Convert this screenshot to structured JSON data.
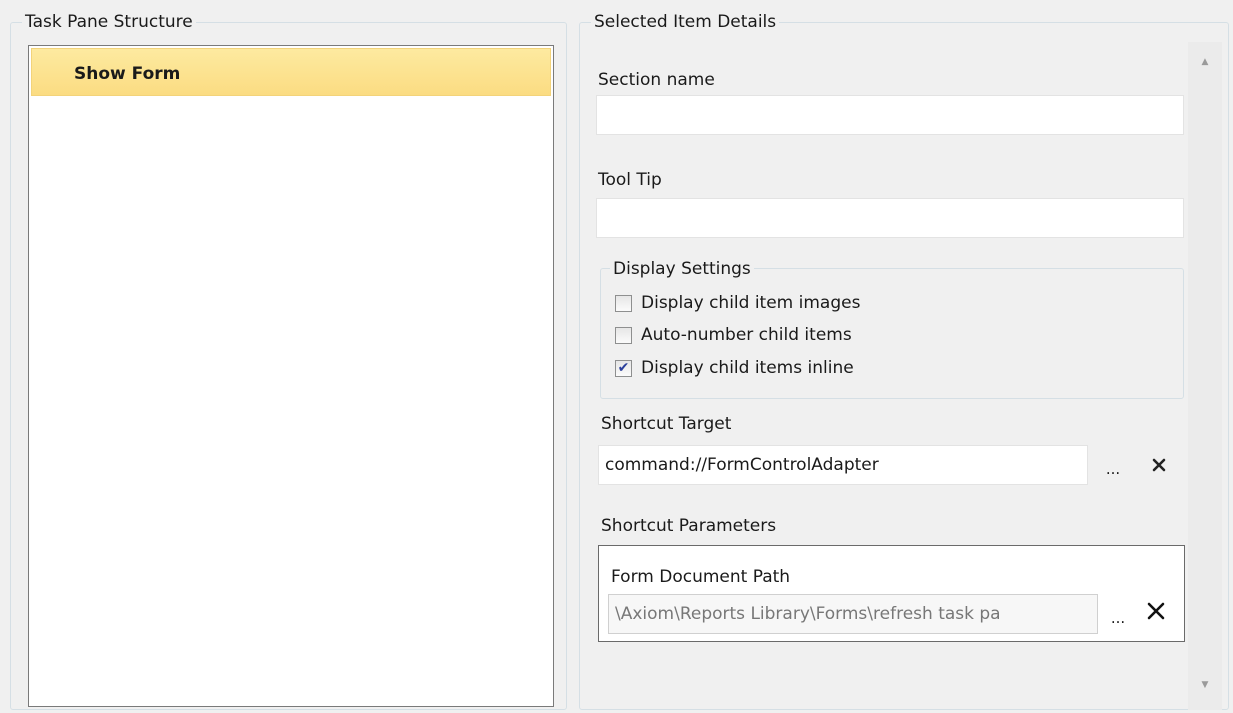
{
  "left_group": {
    "title": "Task Pane Structure",
    "tree_items": [
      {
        "label": "Show Form"
      }
    ]
  },
  "right_group": {
    "title": "Selected Item Details",
    "section_name": {
      "label": "Section name",
      "value": ""
    },
    "tool_tip": {
      "label": "Tool Tip",
      "value": ""
    },
    "display_settings": {
      "title": "Display Settings",
      "options": [
        {
          "label": "Display child item images",
          "checked": false
        },
        {
          "label": "Auto-number child items",
          "checked": false
        },
        {
          "label": "Display child items inline",
          "checked": true
        }
      ]
    },
    "shortcut_target": {
      "label": "Shortcut Target",
      "value": "command://FormControlAdapter",
      "browse_label": "...",
      "clear_icon": "close-icon"
    },
    "shortcut_parameters": {
      "label": "Shortcut Parameters",
      "param_label": "Form Document Path",
      "param_value": "\\Axiom\\Reports Library\\Forms\\refresh task pa",
      "browse_label": "...",
      "clear_icon": "close-icon"
    }
  },
  "colors": {
    "selection": "#fbdc82",
    "background": "#f0f0f0",
    "check_mark": "#2a3f9b"
  }
}
